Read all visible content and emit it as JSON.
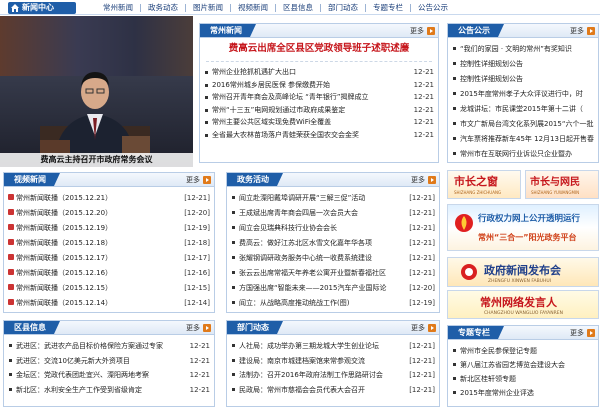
{
  "nav": {
    "home": "新闻中心",
    "links": [
      "常州新闻",
      "政务动态",
      "图片新闻",
      "视频新闻",
      "区县信息",
      "部门动态",
      "专题专栏",
      "公告公示"
    ]
  },
  "photo": {
    "caption": "费高云主持召开市政府常务会议"
  },
  "changzhou_news": {
    "title": "常州新闻",
    "more": "更多",
    "headline": "费高云出席全区县区党政领导班子述职述廉",
    "items": [
      {
        "text": "常州企业抢抓机遇扩大出口",
        "date": "12-21"
      },
      {
        "text": "2016常州城乡居民医保 参保缴费开始",
        "date": "12-21"
      },
      {
        "text": "常州召开青年商会及高峰论坛 “青年银行”揭牌成立",
        "date": "12-21"
      },
      {
        "text": "常州“十三五”电网规划通过市政府成果鉴定",
        "date": "12-21"
      },
      {
        "text": "常州主要公共区域实现免费WiFi全覆盖",
        "date": "12-21"
      },
      {
        "text": "全省最大农林苗场落户青蛙荣获全国农交会金奖",
        "date": "12-21"
      }
    ]
  },
  "notices": {
    "title": "公告公示",
    "more": "更多",
    "items": [
      "“我们的家园 · 文明的常州”有奖知识",
      "控制性详细规划公告",
      "控制性详细规划公告",
      "2015年度常州孝子大众评议进行中，时",
      "龙城讲坛：市民课堂2015年第十二讲（",
      "市文广新局台湾文化系列展2015“六个一批",
      "汽车票将推荐新车45年 12月13日起开售春",
      "常州市在互联网行业诉讼只企业暨办"
    ]
  },
  "video": {
    "title": "视频新闻",
    "more": "更多",
    "items": [
      {
        "text": "常州新闻联播（2015.12.21）",
        "date": "[12-21]"
      },
      {
        "text": "常州新闻联播（2015.12.20）",
        "date": "[12-20]"
      },
      {
        "text": "常州新闻联播（2015.12.19）",
        "date": "[12-19]"
      },
      {
        "text": "常州新闻联播（2015.12.18）",
        "date": "[12-18]"
      },
      {
        "text": "常州新闻联播（2015.12.17）",
        "date": "[12-17]"
      },
      {
        "text": "常州新闻联播（2015.12.16）",
        "date": "[12-16]"
      },
      {
        "text": "常州新闻联播（2015.12.15）",
        "date": "[12-15]"
      },
      {
        "text": "常州新闻联播（2015.12.14）",
        "date": "[12-14]"
      }
    ]
  },
  "gov": {
    "title": "政务活动",
    "more": "更多",
    "items": [
      {
        "text": "阎立赴溧阳戴埠调研开展“三解三促”活动",
        "date": "[12-21]"
      },
      {
        "text": "王成斌出席青年商会四届一次会员大会",
        "date": "[12-21]"
      },
      {
        "text": "阎立会见瑞典科技行业协会会长",
        "date": "[12-21]"
      },
      {
        "text": "费高云：做好江苏北区水雪文化嘉年华各项",
        "date": "[12-21]"
      },
      {
        "text": "张耀钢调研政务服务中心统一收费系统建设",
        "date": "[12-21]"
      },
      {
        "text": "张云云出席常福天年养老公寓开业暨新春福社区",
        "date": "[12-21]"
      },
      {
        "text": "方国强出席“智能未来——2015汽车产业国际论",
        "date": "[12-20]"
      },
      {
        "text": "阎立：从战略高度推动统战工作(图)",
        "date": "[12-19]"
      }
    ]
  },
  "ads": {
    "mayor": "市长之窗",
    "mayor_en": "SHIZHANG ZHICHUANG",
    "citizen": "市长与网民",
    "citizen_en": "SHIZHANG YUWANGMIN",
    "power_top": "行政权力网上公开透明运行",
    "power_mid": "常州“三合一”阳光政务平台",
    "release": "政府新闻发布会",
    "release_en": "ZHENGFU XINWEN FABUHUI",
    "spokes": "常州网络发言人",
    "spokes_en": "CHANGZHOU WANGLUO FAYANREN"
  },
  "district": {
    "title": "区县信息",
    "more": "更多",
    "items": [
      {
        "text": "武进区：武进农产品目标价格保险方案通过专家",
        "date": "12-21"
      },
      {
        "text": "武进区：交流10亿美元新大外资项目",
        "date": "12-21"
      },
      {
        "text": "金坛区：党政代表团赴宜兴、溧阳两地考察",
        "date": "12-21"
      },
      {
        "text": "新北区：水利安全生产工作受到省级肯定",
        "date": "12-21"
      }
    ]
  },
  "dept": {
    "title": "部门动态",
    "more": "更多",
    "items": [
      {
        "text": "人社局：成功举办第三期龙城大学生创业论坛",
        "date": "[12-21]"
      },
      {
        "text": "建设局：南京市城建档案馆来常参观交流",
        "date": "[12-21]"
      },
      {
        "text": "法制办：召开2016年政府法制工作思路研讨会",
        "date": "[12-21]"
      },
      {
        "text": "民政局：常州市慈福会会员代表大会召开",
        "date": "[12-21]"
      }
    ]
  },
  "special": {
    "title": "专题专栏",
    "more": "更多",
    "items": [
      "常州市全民参保登记专题",
      "第八届江苏省园艺博览会建设大会",
      "新北区桂轩领专题",
      "2015年度常州企业评选"
    ]
  },
  "colors": {
    "primary": "#1f5ea8",
    "headline": "#c6161c",
    "border": "#b9cde6"
  }
}
